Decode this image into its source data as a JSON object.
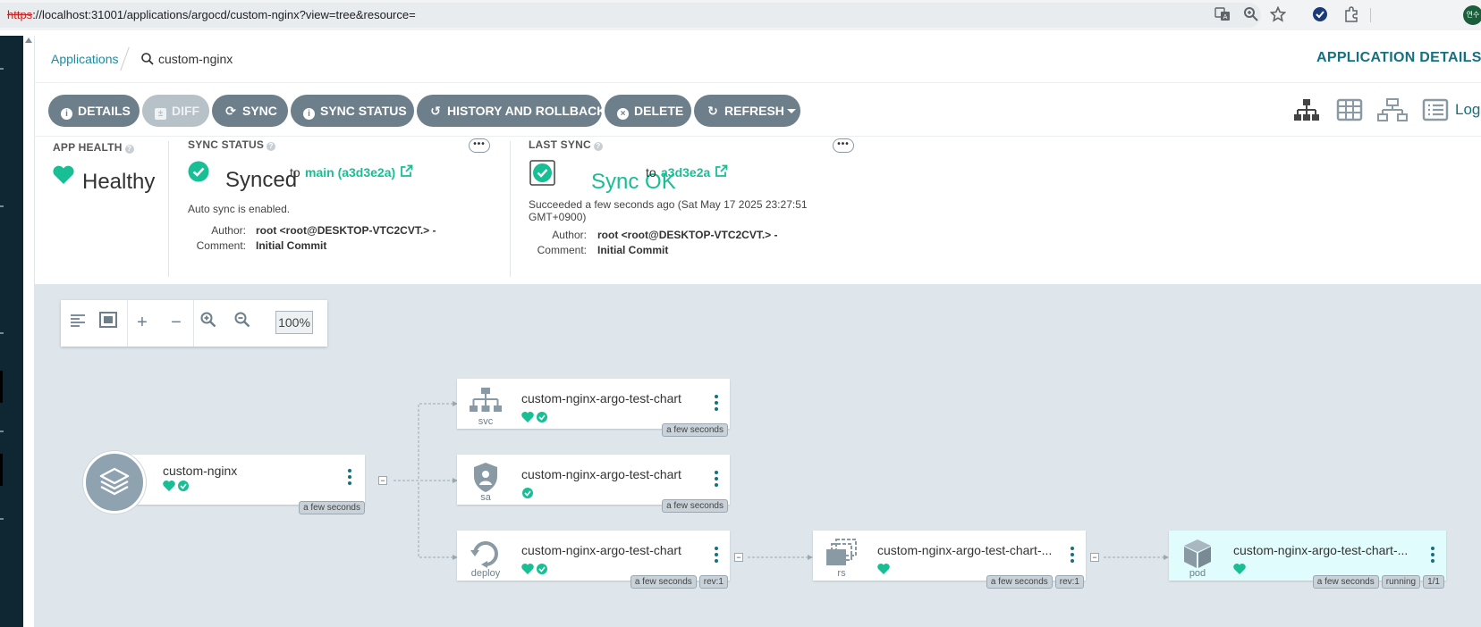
{
  "browser": {
    "url_scheme": "https",
    "url_rest": "://localhost:31001/applications/argocd/custom-nginx?view=tree&resource=",
    "profile_label": "연수"
  },
  "breadcrumb": {
    "applications": "Applications",
    "current": "custom-nginx"
  },
  "page_title": "APPLICATION DETAILS T",
  "toolbar": {
    "details": "DETAILS",
    "diff": "DIFF",
    "sync": "SYNC",
    "sync_status": "SYNC STATUS",
    "history": "HISTORY AND ROLLBACK",
    "delete": "DELETE",
    "refresh": "REFRESH",
    "logs": "Log"
  },
  "app_health": {
    "label": "APP HEALTH",
    "value": "Healthy"
  },
  "sync_status": {
    "label": "SYNC STATUS",
    "value": "Synced",
    "to": "to",
    "revision": "main (a3d3e2a)",
    "auto_sync": "Auto sync is enabled.",
    "author_label": "Author:",
    "author": "root <root@DESKTOP-VTC2CVT.> -",
    "comment_label": "Comment:",
    "comment": "Initial Commit"
  },
  "last_sync": {
    "label": "LAST SYNC",
    "value": "Sync OK",
    "to": "to",
    "revision": "a3d3e2a",
    "succeeded_line1": "Succeeded a few seconds ago (Sat May 17 2025 23:27:51",
    "succeeded_line2": "GMT+0900)",
    "author_label": "Author:",
    "author": "root <root@DESKTOP-VTC2CVT.> -",
    "comment_label": "Comment:",
    "comment": "Initial Commit"
  },
  "zoom": {
    "value": "100%"
  },
  "tree": {
    "app": {
      "name": "custom-nginx",
      "age": "a few seconds"
    },
    "svc": {
      "name": "custom-nginx-argo-test-chart",
      "kind": "svc",
      "age": "a few seconds"
    },
    "sa": {
      "name": "custom-nginx-argo-test-chart",
      "kind": "sa",
      "age": "a few seconds"
    },
    "deploy": {
      "name": "custom-nginx-argo-test-chart",
      "kind": "deploy",
      "age": "a few seconds",
      "rev": "rev:1"
    },
    "rs": {
      "name": "custom-nginx-argo-test-chart-...",
      "kind": "rs",
      "age": "a few seconds",
      "rev": "rev:1"
    },
    "pod": {
      "name": "custom-nginx-argo-test-chart-...",
      "kind": "pod",
      "age": "a few seconds",
      "state": "running",
      "ready": "1/1"
    }
  },
  "colors": {
    "accent": "#18be94",
    "brand": "#16707f",
    "button": "#6d7f8b",
    "canvas": "#dee6eb"
  }
}
